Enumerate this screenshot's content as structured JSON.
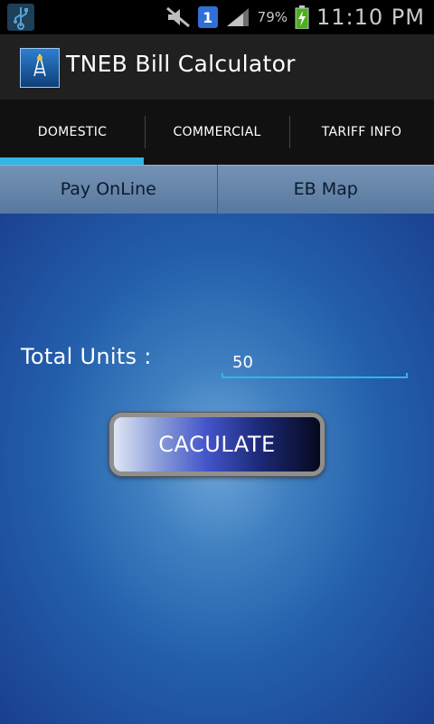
{
  "status_bar": {
    "notification_count": "1",
    "battery_percent": "79%",
    "time": "11:10 PM",
    "icons": [
      "usb-icon",
      "mute-icon",
      "signal-icon",
      "battery-charging-icon"
    ]
  },
  "app": {
    "title": "TNEB Bill Calculator",
    "icon_text": "TNEB BILL CALCULATOR"
  },
  "tabs": [
    {
      "label": "DOMESTIC",
      "selected": true
    },
    {
      "label": "COMMERCIAL",
      "selected": false
    },
    {
      "label": "TARIFF INFO",
      "selected": false
    }
  ],
  "actions": {
    "pay_online": "Pay OnLine",
    "eb_map": "EB Map"
  },
  "form": {
    "units_label": "Total Units :",
    "units_value": "50",
    "calculate_label": "CACULATE"
  },
  "colors": {
    "tab_indicator": "#33b5e5",
    "content_bg": "#235fac"
  }
}
